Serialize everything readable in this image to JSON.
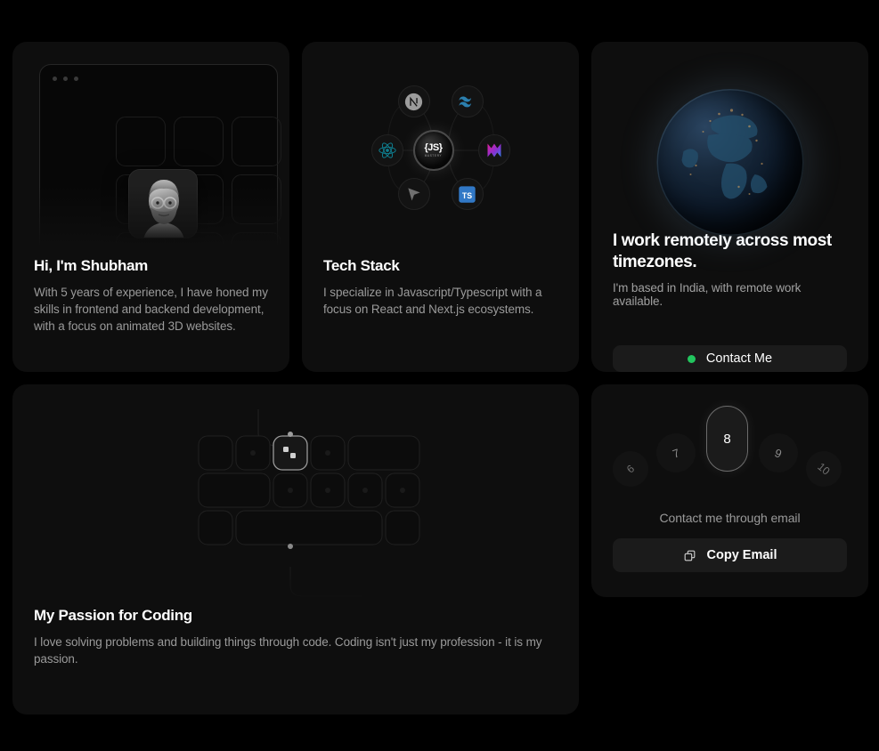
{
  "theme": {
    "page_bg": "#000000",
    "card_bg": "#0e0e0e",
    "text_primary": "#ffffff",
    "text_secondary": "#9a9a9a",
    "accent_green": "#22c55e",
    "button_bg": "#1b1b1b"
  },
  "cards": {
    "intro": {
      "title": "Hi, I'm Shubham",
      "body": "With 5 years of experience, I have honed my skills in frontend and backend development, with a focus on animated 3D websites.",
      "window_dots": 3,
      "avatar_alt": "avatar"
    },
    "tech_stack": {
      "title": "Tech Stack",
      "body": "I specialize in Javascript/Typescript with a focus on React and Next.js ecosystems.",
      "hub": {
        "label": "{JS}",
        "sublabel": "MASTERY"
      },
      "icons": [
        {
          "name": "nextjs-icon",
          "label": "N",
          "color": "#9c9c9c"
        },
        {
          "name": "tailwind-icon",
          "label": "Tailwind CSS",
          "color": "#2b7fae"
        },
        {
          "name": "react-icon",
          "label": "React",
          "color": "#0e7d8e"
        },
        {
          "name": "framer-motion-icon",
          "label": "Framer Motion",
          "color": "#c026d3"
        },
        {
          "name": "vercel-cursor-icon",
          "label": "Cursor",
          "color": "#8a8a8a"
        },
        {
          "name": "typescript-icon",
          "label": "TS",
          "color": "#3178c6"
        }
      ]
    },
    "timezone": {
      "title": "I work remotely across most timezones.",
      "subtitle": "I'm based in India, with remote work available.",
      "button_label": "Contact Me",
      "status_color": "#22c55e",
      "globe_alt": "earth-at-night-globe"
    },
    "passion": {
      "title": "My Passion for Coding",
      "body": "I love solving problems and building things through code. Coding isn't just my profession - it is my passion."
    },
    "email": {
      "numbers": [
        "6",
        "7",
        "8",
        "9",
        "10"
      ],
      "active_index": 2,
      "caption": "Contact me through email",
      "button_label": "Copy Email",
      "button_icon": "copy-icon"
    }
  }
}
